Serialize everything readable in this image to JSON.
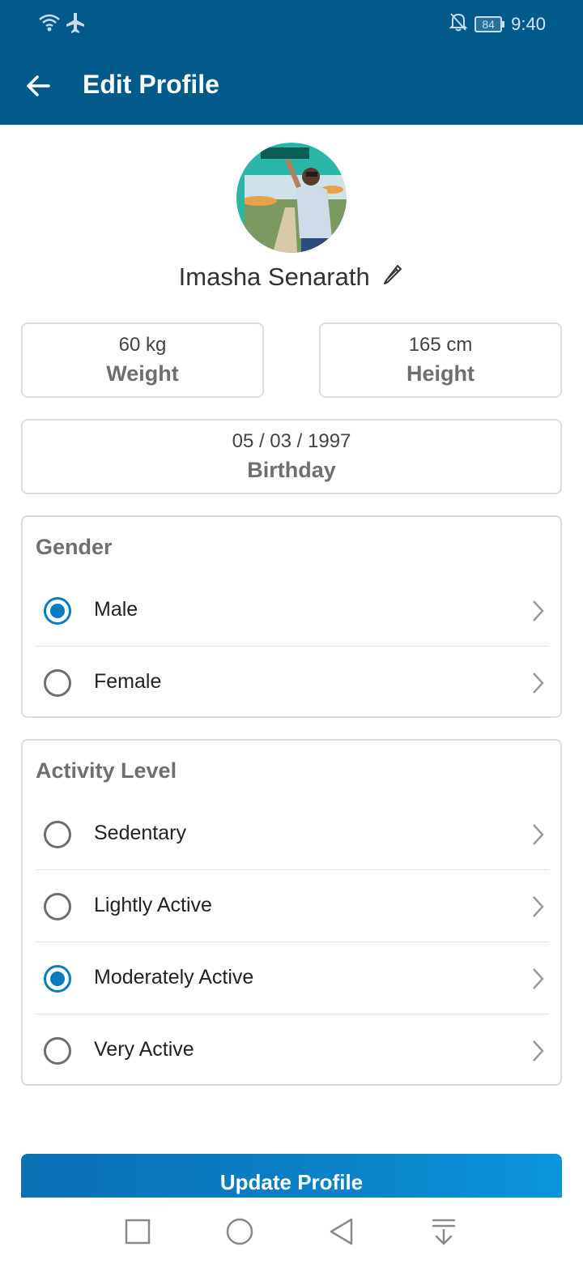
{
  "status_bar": {
    "time": "9:40",
    "battery_level": "84",
    "icons": [
      "wifi-icon",
      "airplane-icon",
      "bell-off-icon",
      "battery-icon"
    ]
  },
  "app_bar": {
    "title": "Edit Profile",
    "back_icon": "arrow-left-icon"
  },
  "profile": {
    "name": "Imasha Senarath",
    "edit_icon": "pencil-icon",
    "avatar": "profile-photo"
  },
  "stats": {
    "weight": {
      "value": "60 kg",
      "label": "Weight"
    },
    "height": {
      "value": "165 cm",
      "label": "Height"
    },
    "birthday": {
      "value": "05 / 03 / 1997",
      "label": "Birthday"
    }
  },
  "gender": {
    "title": "Gender",
    "options": [
      {
        "label": "Male",
        "selected": true
      },
      {
        "label": "Female",
        "selected": false
      }
    ]
  },
  "activity": {
    "title": "Activity Level",
    "options": [
      {
        "label": "Sedentary",
        "selected": false
      },
      {
        "label": "Lightly Active",
        "selected": false
      },
      {
        "label": "Moderately Active",
        "selected": true
      },
      {
        "label": "Very Active",
        "selected": false
      }
    ]
  },
  "update_button": {
    "label": "Update Profile"
  },
  "nav_bar": {
    "icons": [
      "recent-apps-icon",
      "home-icon",
      "back-triangle-icon",
      "notification-pull-icon"
    ]
  },
  "colors": {
    "primary": "#025a8a",
    "accent": "#0a7cc1",
    "border": "#dcdcdc"
  }
}
